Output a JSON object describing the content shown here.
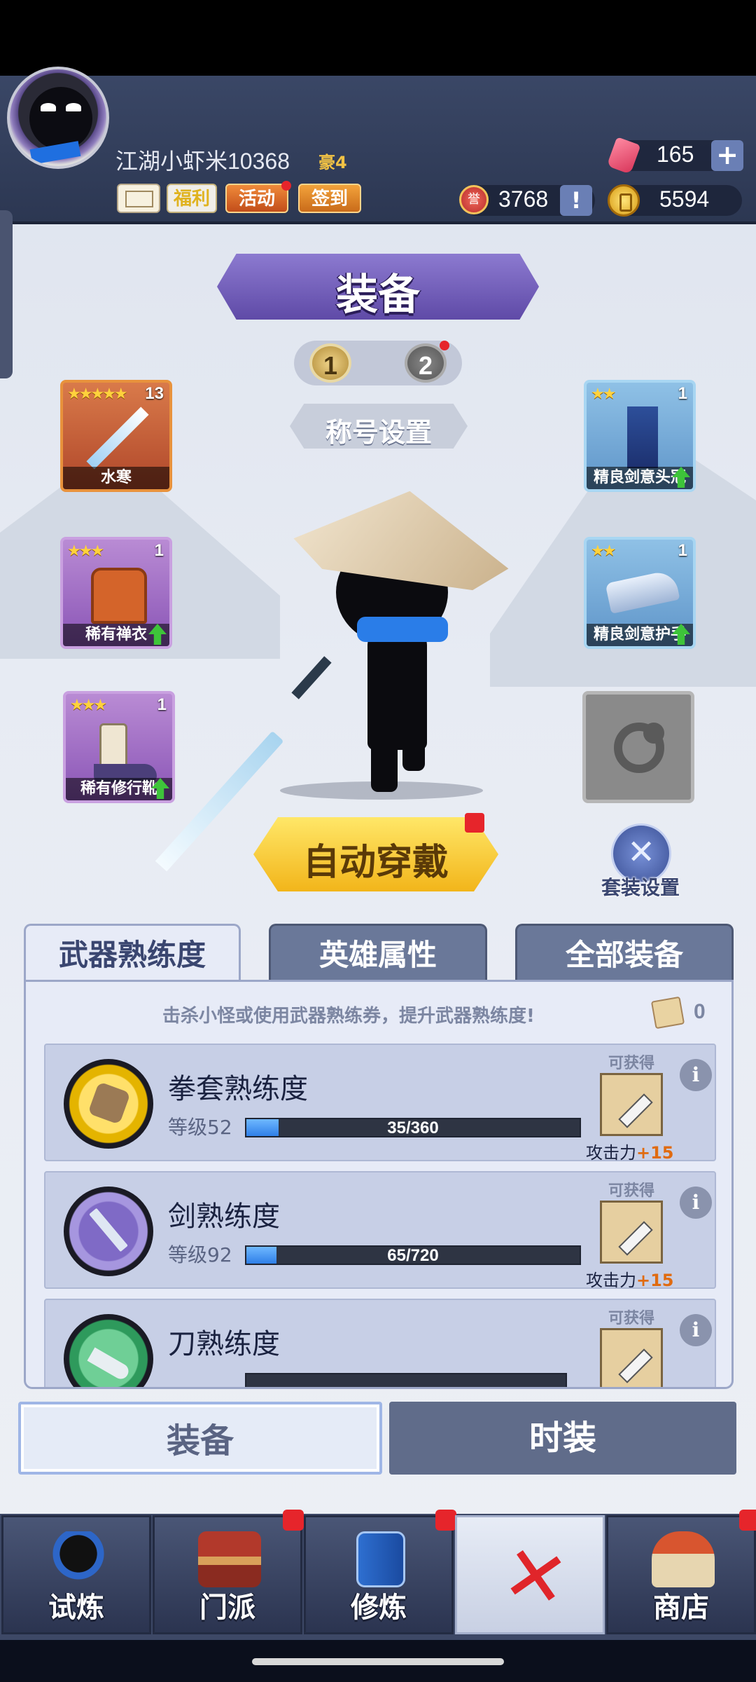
{
  "header": {
    "player_name": "江湖小虾米10368",
    "vip": "豪4",
    "buttons": {
      "mail": "",
      "welfare": "福利",
      "activity": "活动",
      "signin": "签到"
    },
    "currency": {
      "gems": "165",
      "honor": "3768",
      "gold": "5594"
    },
    "honor_badge": "誉"
  },
  "main": {
    "title": "装备",
    "pages": [
      "1",
      "2"
    ],
    "title_setting": "称号设置",
    "slots": {
      "weapon": {
        "stars": "★★★★★",
        "count": "13",
        "name": "水寒"
      },
      "armor": {
        "stars": "★★★",
        "count": "1",
        "name": "稀有禅衣"
      },
      "boots": {
        "stars": "★★★",
        "count": "1",
        "name": "稀有修行靴"
      },
      "helmet": {
        "stars": "★★",
        "count": "1",
        "name": "精良剑意头冠"
      },
      "gloves": {
        "stars": "★★",
        "count": "1",
        "name": "精良剑意护手"
      }
    },
    "auto_equip": "自动穿戴",
    "suit_setting": "套装设置"
  },
  "tabs": [
    "武器熟练度",
    "英雄属性",
    "全部装备"
  ],
  "proficiency": {
    "hint": "击杀小怪或使用武器熟练券，提升武器熟练度!",
    "ticket_count": "0",
    "available_label": "可获得",
    "info": "i",
    "rows": [
      {
        "title": "拳套熟练度",
        "level": "等级52",
        "progress_text": "35/360",
        "progress": 0.097,
        "reward_label": "攻击力",
        "reward_value": "+15"
      },
      {
        "title": "剑熟练度",
        "level": "等级92",
        "progress_text": "65/720",
        "progress": 0.09,
        "reward_label": "攻击力",
        "reward_value": "+15"
      },
      {
        "title": "刀熟练度",
        "level": "",
        "progress_text": "",
        "progress": 0,
        "reward_label": "",
        "reward_value": ""
      }
    ]
  },
  "bottom_switch": [
    "装备",
    "时装"
  ],
  "nav": [
    "试炼",
    "门派",
    "修炼",
    "",
    "商店"
  ],
  "colors": {
    "header_bg": "#2c3752",
    "accent_purple": "#5f4aa7",
    "button_gold": "#f2b51a",
    "reward_orange": "#e06b10",
    "notify_red": "#e6252b"
  }
}
